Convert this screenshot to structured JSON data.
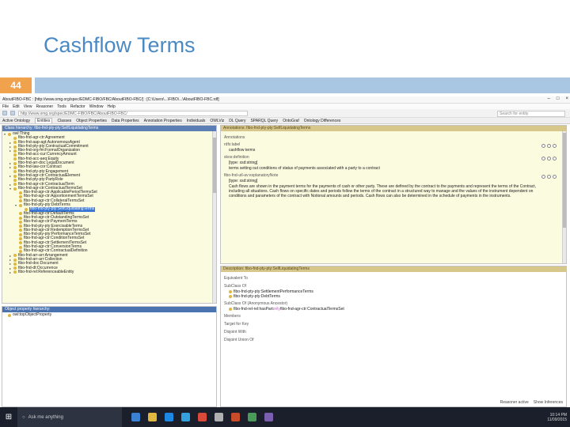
{
  "slide": {
    "title": "Cashflow Terms",
    "number": "44"
  },
  "window": {
    "title": "AboutFIBO-FBC : [http://www.omg.org/spec/EDMC-FIBO/FBC/AboutFIBO-FBC/] : [C:\\Users\\...\\FIBO\\...\\AboutFIBO-FBC.rdf]",
    "menu": [
      "File",
      "Edit",
      "View",
      "Reasoner",
      "Tools",
      "Refactor",
      "Window",
      "Help"
    ],
    "address": "http://www.omg.org/spec/EDMC-FIBO/FBC/AboutFIBO-FBC/",
    "search_placeholder": "Search for entity",
    "tabs": [
      "Active Ontology",
      "Entities",
      "Classes",
      "Object Properties",
      "Data Properties",
      "Annotation Properties",
      "Individuals",
      "OWLViz",
      "DL Query",
      "SPARQL Query",
      "OntoGraf",
      "Ontology Differences"
    ],
    "active_tab_index": 1
  },
  "class_hierarchy": {
    "header": "Class hierarchy: fibo-fnd-pty-pty:SelfLiquidatingTerms",
    "items": [
      {
        "label": "owl:Thing",
        "depth": 0,
        "expander": "▾"
      },
      {
        "label": "fibo-fnd-agr-ctr:Agreement",
        "depth": 1,
        "expander": ""
      },
      {
        "label": "fibo-fnd-aap-agt:AutonomousAgent",
        "depth": 1,
        "expander": "▸"
      },
      {
        "label": "fibo-fnd-pty-pty:ContractualCommitment",
        "depth": 1,
        "expander": "▸"
      },
      {
        "label": "fibo-fnd-org-fm:FormalOrganization",
        "depth": 1,
        "expander": "▸"
      },
      {
        "label": "fibo-fnd-acc-cur:CurrencyAmount",
        "depth": 1,
        "expander": ""
      },
      {
        "label": "fibo-fnd-acc-aeq:Equity",
        "depth": 1,
        "expander": ""
      },
      {
        "label": "fibo-fnd-arr-doc:LegalDocument",
        "depth": 1,
        "expander": "▸"
      },
      {
        "label": "fibo-fnd-law-cor:Contract",
        "depth": 1,
        "expander": "▸"
      },
      {
        "label": "fibo-fnd-pty-pty:Engagement",
        "depth": 1,
        "expander": ""
      },
      {
        "label": "fibo-fnd-agr-ctr:ContractualElement",
        "depth": 1,
        "expander": "▸"
      },
      {
        "label": "fibo-fnd-pty-pty:PartyRole",
        "depth": 1,
        "expander": ""
      },
      {
        "label": "fibo-fnd-agr-ctr:ContractualTerm",
        "depth": 1,
        "expander": "▸"
      },
      {
        "label": "fibo-fnd-agr-ctr:ContractualTermsSet",
        "depth": 1,
        "expander": "▾"
      },
      {
        "label": "fibo-fnd-agr-ctr:ApplicablePeriodTermsSet",
        "depth": 2,
        "expander": ""
      },
      {
        "label": "fibo-fnd-agr-ctr:ApportionmentTermsSet",
        "depth": 2,
        "expander": ""
      },
      {
        "label": "fibo-fnd-agr-ctr:CollateralTermsSet",
        "depth": 2,
        "expander": ""
      },
      {
        "label": "fibo-fnd-pty-pty:DebtTerms",
        "depth": 2,
        "expander": "▾"
      },
      {
        "label": "fibo-fnd-pty-pty:SelfLiquidatingTerms",
        "depth": 3,
        "expander": "",
        "selected": true
      },
      {
        "label": "fibo-fnd-agr-ctr:DefaultTerms",
        "depth": 2,
        "expander": ""
      },
      {
        "label": "fibo-fnd-agr-ctr:OutstandingTermsSet",
        "depth": 2,
        "expander": ""
      },
      {
        "label": "fibo-fnd-agr-ctr:PaymentTerms",
        "depth": 2,
        "expander": ""
      },
      {
        "label": "fibo-fnd-pty-pty:ExercisableTerms",
        "depth": 2,
        "expander": ""
      },
      {
        "label": "fibo-fnd-agr-ctr:RedemptionTermsSet",
        "depth": 2,
        "expander": ""
      },
      {
        "label": "fibo-fnd-pty-pty:PerformanceTermsSet",
        "depth": 2,
        "expander": ""
      },
      {
        "label": "fibo-fnd-agr-ctr:ConditionTermsSet",
        "depth": 2,
        "expander": ""
      },
      {
        "label": "fibo-fnd-agr-ctr:SettlementTermsSet",
        "depth": 2,
        "expander": ""
      },
      {
        "label": "fibo-fnd-agr-ctr:ConversionTerms",
        "depth": 2,
        "expander": ""
      },
      {
        "label": "fibo-fnd-agr-ctr:ContractualDefinition",
        "depth": 2,
        "expander": ""
      },
      {
        "label": "fibo-fnd-arr-arr:Arrangement",
        "depth": 1,
        "expander": "▸"
      },
      {
        "label": "fibo-fnd-arr-arr:Collection",
        "depth": 1,
        "expander": "▸"
      },
      {
        "label": "fibo-fnd-doc:Document",
        "depth": 1,
        "expander": "▸"
      },
      {
        "label": "fibo-fnd-dt:Occurrence",
        "depth": 1,
        "expander": "▸"
      },
      {
        "label": "fibo-fnd-rel:ReferenceableEntity",
        "depth": 1,
        "expander": "▸"
      }
    ]
  },
  "object_property_hierarchy": {
    "header": "Object property hierarchy:",
    "items": [
      {
        "label": "owl:topObjectProperty",
        "depth": 0
      }
    ]
  },
  "annotations": {
    "header": "Annotations: fibo-fnd-pty-pty:SelfLiquidatingTerms",
    "fields": [
      {
        "label": "Annotations",
        "value": ""
      },
      {
        "label": "rdfs:label",
        "value": "cashflow terms"
      },
      {
        "label": "skos:definition",
        "value": "[type: xsd:string]"
      },
      {
        "label": "",
        "value": "terms setting out conditions of status of payments associated with a party to a contract"
      },
      {
        "label": "fibo-fnd-utl-av:explanatoryNote",
        "value": "[type: xsd:string]"
      },
      {
        "label": "",
        "value": "Cash flows are shown in the payment terms for the payments of cash or other party. These are defined by the contract to the payments and represent the terms of the Contract, including all situations. Cash flows on specific dates and periods follow the terms of the contract in a structured way to manage and the values of the instrument dependent on conditions and parameters of the contract with Notional amounts and periods. Cash flows can also be determined in the schedule of payments in the instruments."
      }
    ]
  },
  "description": {
    "header": "Description: fibo-fnd-pty-pty:SelfLiquidatingTerms",
    "sections": [
      {
        "label": "Equivalent To",
        "items": []
      },
      {
        "label": "SubClass Of",
        "items": [
          {
            "text": "fibo-fnd-pty-pty:SettlementPerformanceTerms"
          },
          {
            "text": "fibo-fnd-pty-pty:DebtTerms"
          }
        ]
      },
      {
        "label": "SubClass Of (Anonymous Ancestor)",
        "items": [
          {
            "text": "fibo-fnd-rel-rel:hasPart",
            "kw": "only",
            "text2": "fibo-fnd-agr-ctr:ContractualTermsSet"
          }
        ]
      },
      {
        "label": "Members",
        "items": []
      },
      {
        "label": "Target for Key",
        "items": []
      },
      {
        "label": "Disjoint With",
        "items": []
      },
      {
        "label": "Disjoint Union Of",
        "items": []
      }
    ],
    "footer": [
      "Reasoner active",
      "Show Inferences"
    ]
  },
  "taskbar": {
    "search_text": "Ask me anything",
    "time": "10:14 PM",
    "date": "11/09/2015",
    "icon_colors": [
      "#3b82d4",
      "#e0b840",
      "#1e88e5",
      "#33a1de",
      "#d94a3a",
      "#b0b0b0",
      "#c84b2a",
      "#4a9a5a",
      "#7a5fb0"
    ]
  }
}
